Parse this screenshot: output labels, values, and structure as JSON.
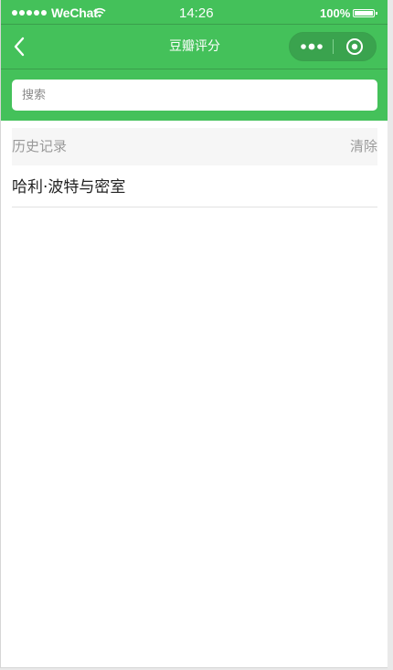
{
  "status_bar": {
    "carrier": "WeChat",
    "time": "14:26",
    "battery": "100%"
  },
  "nav": {
    "title": "豆瓣评分"
  },
  "search": {
    "placeholder": "搜索"
  },
  "history": {
    "title": "历史记录",
    "clear_label": "清除",
    "items": [
      "哈利·波特与密室"
    ]
  },
  "colors": {
    "brand_green": "#44c15a",
    "capsule_bg": "#3aa34e",
    "history_header_bg": "#f6f6f6"
  },
  "icons": {
    "back": "chevron-left-icon",
    "more": "more-dots-icon",
    "close": "target-circle-icon",
    "wifi": "wifi-icon",
    "battery": "battery-icon",
    "signal": "signal-dots-icon"
  }
}
